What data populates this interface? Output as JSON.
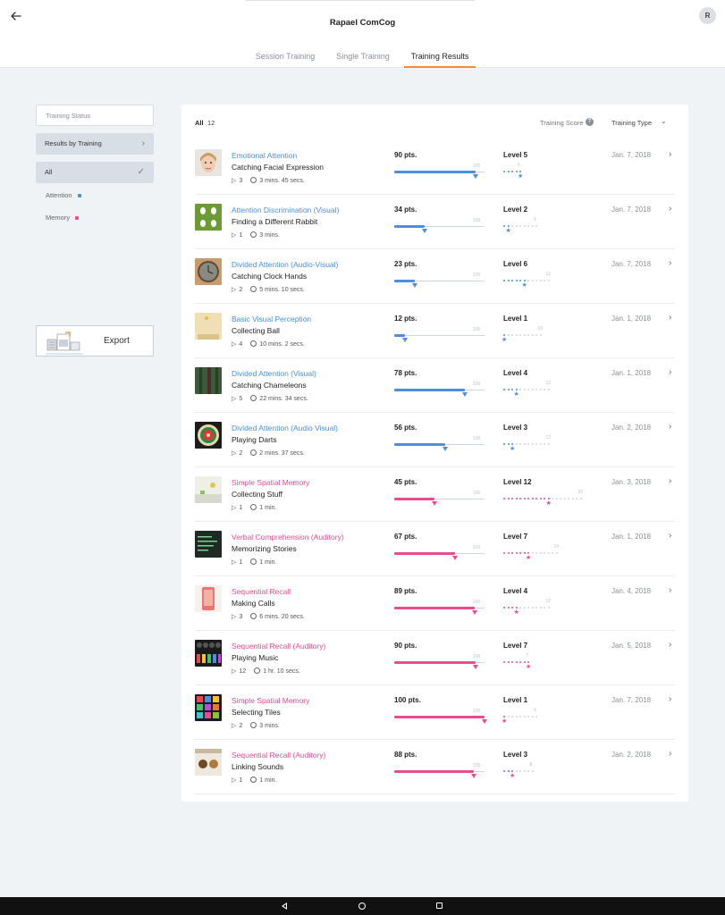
{
  "header": {
    "title": "Rapael ComCog",
    "avatar_initial": "R",
    "tabs": [
      {
        "label": "Session Training"
      },
      {
        "label": "Single Training"
      },
      {
        "label": "Training Results"
      }
    ]
  },
  "sidebar": {
    "status_label": "Training Status",
    "results_label": "Results by Training",
    "all_label": "All",
    "filters": [
      {
        "label": "Attention",
        "color": "#4a8fe0"
      },
      {
        "label": "Memory",
        "color": "#ec4b8f"
      }
    ],
    "export_label": "Export"
  },
  "list": {
    "all_label": "All",
    "count": "12",
    "score_label": "Training Score",
    "type_label": "Training Type",
    "items": [
      {
        "category": "Emotional Attention",
        "game": "Catching Facial Expression",
        "plays": "3",
        "duration": "3 mins. 45 secs.",
        "points": "90 pts.",
        "score": 90,
        "score_max_label": "100",
        "level": "Level 5",
        "level_value": 5,
        "level_max": 5,
        "level_max_label": "5",
        "date": "Jan. 7, 2018",
        "color": "#4a8fe0",
        "thumb": "face"
      },
      {
        "category": "Attention Discrimination (Visual)",
        "game": "Finding a Different Rabbit",
        "plays": "1",
        "duration": "3 mins.",
        "points": "34 pts.",
        "score": 34,
        "score_max_label": "100",
        "level": "Level 2",
        "level_value": 2,
        "level_max": 9,
        "level_max_label": "9",
        "date": "Jan. 7, 2018",
        "color": "#4a8fe0",
        "thumb": "rabbit"
      },
      {
        "category": "Divided Attention (Audio-Visual)",
        "game": "Catching Clock Hands",
        "plays": "2",
        "duration": "5 mins. 10 secs.",
        "points": "23 pts.",
        "score": 23,
        "score_max_label": "100",
        "level": "Level 6",
        "level_value": 6,
        "level_max": 12,
        "level_max_label": "12",
        "date": "Jan. 7, 2018",
        "color": "#4a8fe0",
        "thumb": "clock"
      },
      {
        "category": "Basic Visual Perception",
        "game": "Collecting Ball",
        "plays": "4",
        "duration": "10 mins. 2 secs.",
        "points": "12 pts.",
        "score": 12,
        "score_max_label": "100",
        "level": "Level 1",
        "level_value": 1,
        "level_max": 10,
        "level_max_label": "10",
        "date": "Jan. 1, 2018",
        "color": "#4a8fe0",
        "thumb": "ball"
      },
      {
        "category": "Divided Attention (Visual)",
        "game": "Catching Chameleons",
        "plays": "5",
        "duration": "22 mins. 34 secs.",
        "points": "78 pts.",
        "score": 78,
        "score_max_label": "100",
        "level": "Level 4",
        "level_value": 4,
        "level_max": 12,
        "level_max_label": "12",
        "date": "Jan. 1, 2018",
        "color": "#4a8fe0",
        "thumb": "forest"
      },
      {
        "category": "Divided Attention (Audio Visual)",
        "game": "Playing Darts",
        "plays": "2",
        "duration": "2 mins. 37 secs.",
        "points": "56 pts.",
        "score": 56,
        "score_max_label": "100",
        "level": "Level 3",
        "level_value": 3,
        "level_max": 12,
        "level_max_label": "12",
        "date": "Jan. 2, 2018",
        "color": "#4a8fe0",
        "thumb": "darts"
      },
      {
        "category": "Simple Spatial Memory",
        "game": "Collecting Stuff",
        "plays": "1",
        "duration": "1 min.",
        "points": "45 pts.",
        "score": 45,
        "score_max_label": "100",
        "level": "Level 12",
        "level_value": 12,
        "level_max": 20,
        "level_max_label": "20",
        "date": "Jan. 3, 2018",
        "color": "#ec4b8f",
        "thumb": "stuff"
      },
      {
        "category": "Verbal Comprehension (Auditory)",
        "game": "Memorizing Stories",
        "plays": "1",
        "duration": "1 min.",
        "points": "67 pts.",
        "score": 67,
        "score_max_label": "100",
        "level": "Level 7",
        "level_value": 7,
        "level_max": 14,
        "level_max_label": "14",
        "date": "Jan. 1, 2018",
        "color": "#ec4b8f",
        "thumb": "stories"
      },
      {
        "category": "Sequential Recall",
        "game": "Making Calls",
        "plays": "3",
        "duration": "6 mins. 20 secs.",
        "points": "89 pts.",
        "score": 89,
        "score_max_label": "100",
        "level": "Level 4",
        "level_value": 4,
        "level_max": 12,
        "level_max_label": "12",
        "date": "Jan. 4, 2018",
        "color": "#ec4b8f",
        "thumb": "phone"
      },
      {
        "category": "Sequential Recall (Auditory)",
        "game": "Playing Music",
        "plays": "12",
        "duration": "1 hr. 10 secs.",
        "points": "90 pts.",
        "score": 90,
        "score_max_label": "100",
        "level": "Level 7",
        "level_value": 7,
        "level_max": 7,
        "level_max_label": "7",
        "date": "Jan. 5, 2018",
        "color": "#ec4b8f",
        "thumb": "music"
      },
      {
        "category": "Simple Spatial Memory",
        "game": "Selecting Tiles",
        "plays": "2",
        "duration": "3 mins.",
        "points": "100 pts.",
        "score": 100,
        "score_max_label": "100",
        "level": "Level 1",
        "level_value": 1,
        "level_max": 9,
        "level_max_label": "9",
        "date": "Jan. 7, 2018",
        "color": "#ec4b8f",
        "thumb": "tiles"
      },
      {
        "category": "Sequential Recall (Auditory)",
        "game": "Linking Sounds",
        "plays": "1",
        "duration": "1 min.",
        "points": "88 pts.",
        "score": 88,
        "score_max_label": "100",
        "level": "Level 3",
        "level_value": 3,
        "level_max": 8,
        "level_max_label": "8",
        "date": "Jan. 2, 2018",
        "color": "#ec4b8f",
        "thumb": "sounds"
      }
    ]
  }
}
